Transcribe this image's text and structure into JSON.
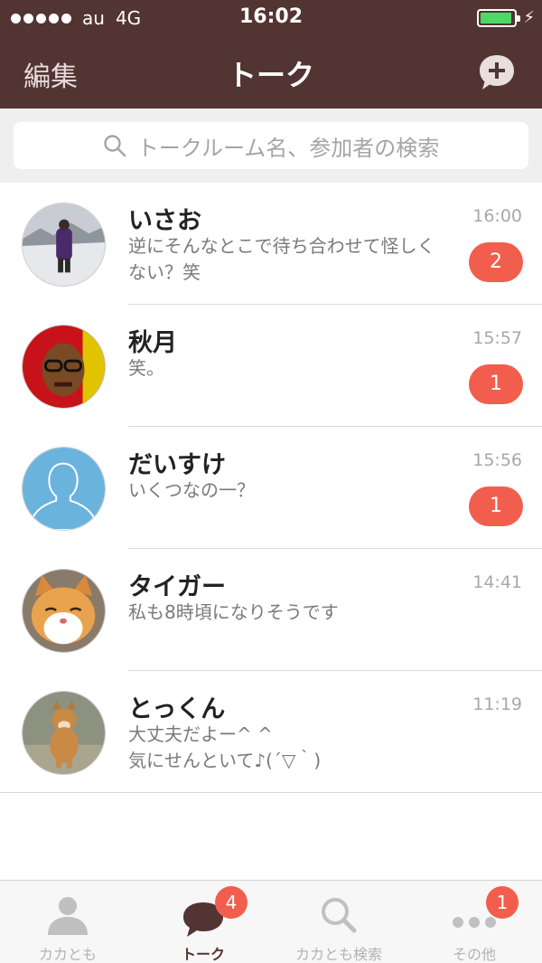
{
  "status_bar": {
    "carrier": "au",
    "network": "4G",
    "time": "16:02"
  },
  "nav": {
    "edit_label": "編集",
    "title": "トーク"
  },
  "search": {
    "placeholder": "トークルーム名、参加者の検索"
  },
  "chats": [
    {
      "name": "いさお",
      "message": "逆にそんなとこで待ち合わせて怪しく\nない？笑",
      "time": "16:00",
      "unread": "2"
    },
    {
      "name": "秋月",
      "message": "笑。",
      "time": "15:57",
      "unread": "1"
    },
    {
      "name": "だいすけ",
      "message": "いくつなの一？",
      "time": "15:56",
      "unread": "1"
    },
    {
      "name": "タイガー",
      "message": "私も8時頃になりそうです",
      "time": "14:41",
      "unread": ""
    },
    {
      "name": "とっくん",
      "message": "大丈夫だよー^ ^\n気にせんといて♪(´▽｀)",
      "time": "11:19",
      "unread": ""
    }
  ],
  "tabs": [
    {
      "label": "カカとも",
      "badge": ""
    },
    {
      "label": "トーク",
      "badge": "4"
    },
    {
      "label": "カカとも検索",
      "badge": ""
    },
    {
      "label": "その他",
      "badge": "1"
    }
  ],
  "colors": {
    "brand": "#523432",
    "badge": "#f25e4d",
    "battery": "#4cd964"
  },
  "icons": [
    "compose-icon",
    "search-icon",
    "friends-icon",
    "talk-icon",
    "more-icon"
  ]
}
